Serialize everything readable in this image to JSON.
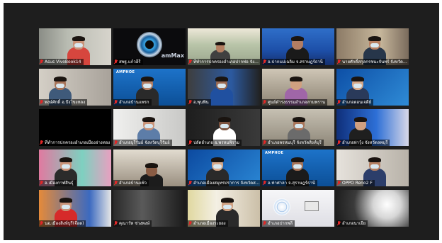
{
  "participants": [
    {
      "name": "Asus VivoBook14",
      "muted": true,
      "scene": "office-window"
    },
    {
      "name": "สพฐ.แก้วอีรี่",
      "muted": true,
      "scene": "webcam-logo"
    },
    {
      "name": "ที่ทำการปกครองอำเภอปากท่อ จังหวัดราชบุรี",
      "muted": true,
      "scene": "windows"
    },
    {
      "name": "อ.ปากแม่เฉลิม จ.สราษฎร์ธานี",
      "muted": true,
      "scene": "blue-banner"
    },
    {
      "name": "นายศักดิ์สกุลกรชนะจันทร์ จังหวัดศรีสะเกษ",
      "muted": true,
      "scene": "uniform"
    },
    {
      "name": "พงษ์ศักดิ์ อ.บึงโขงหลง",
      "muted": true,
      "scene": "masked-man"
    },
    {
      "name": "อำเภอบ้านแพรก",
      "muted": true,
      "scene": "amphoe-banner"
    },
    {
      "name": "อ.พุนพิน",
      "muted": true,
      "scene": "masked-blue"
    },
    {
      "name": "ศูนย์ดำรงธรรมอำเภอสามพราน",
      "muted": true,
      "scene": "office-woman"
    },
    {
      "name": "อำเภอดอนเจดีย์",
      "muted": true,
      "scene": "blue-hex"
    },
    {
      "name": "ที่ทำการปกครองอำเภอเมืองอ่างทอง",
      "muted": true,
      "scene": "dark"
    },
    {
      "name": "อำเภอบุรีรัมย์ จังหวัดบุรีรัมย์",
      "muted": true,
      "scene": "masked-woman"
    },
    {
      "name": "ปลัดอำเภอ อ.พรหมพิราม",
      "muted": true,
      "scene": "dark-man"
    },
    {
      "name": "อำเภอพรหมบุรี จังหวัดสิงห์บุรี",
      "muted": true,
      "scene": "masked-man2"
    },
    {
      "name": "อำเภอท่าวุ้ง จังหวัดลพบุรี",
      "muted": true,
      "scene": "woman-screen"
    },
    {
      "name": "อ.เมืองกาฬสินธุ์",
      "muted": true,
      "scene": "pink-room"
    },
    {
      "name": "อำเภอบ้านแพ้ว",
      "muted": true,
      "scene": "man-table"
    },
    {
      "name": "อำเภอเมืองสมุทรปราการ จังหวัดสมุทรปราการ",
      "muted": true,
      "scene": "blue-hex2"
    },
    {
      "name": "อ.ท่าศาลา จ.สุราษฎร์ธานี",
      "muted": true,
      "scene": "amphoe-banner2"
    },
    {
      "name": "OPPO Reno2 F",
      "muted": true,
      "scene": "masked-right"
    },
    {
      "name": "นอ.เมืองสิงห์บุรี(จ๊อด)",
      "muted": true,
      "scene": "red-man"
    },
    {
      "name": "คุณาวัท ช่วงพงษ์",
      "muted": true,
      "scene": "dark-door"
    },
    {
      "name": "อำเภอเมืองระยอง",
      "muted": true,
      "scene": "flowers-woman"
    },
    {
      "name": "อำเภอปากพลี",
      "muted": true,
      "scene": "white-device"
    },
    {
      "name": "อำเภอนาเยีย",
      "muted": true,
      "scene": "bright-light"
    }
  ],
  "tile_labels": {
    "webcam_brand": "amMax",
    "amphoe_banner": "AMPHOE"
  }
}
